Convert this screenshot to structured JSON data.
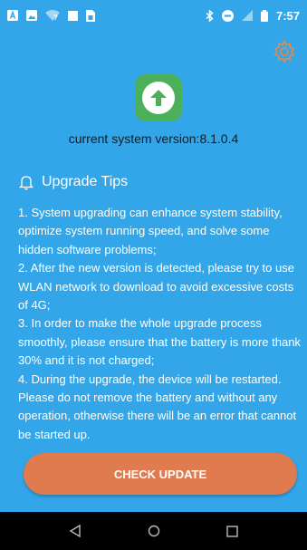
{
  "status_bar": {
    "time": "7:57",
    "left_icons": [
      "notification-a-icon",
      "image-icon",
      "wifi-question-icon",
      "square-icon",
      "sim-icon"
    ],
    "right_icons": [
      "bluetooth-icon",
      "do-not-disturb-icon",
      "signal-icon",
      "battery-icon"
    ]
  },
  "header": {
    "settings_icon": "gear-icon",
    "app_icon": "upgrade-arrow-icon",
    "version_text": "current system version:8.1.0.4"
  },
  "tips": {
    "title": "Upgrade Tips",
    "icon": "bell-icon",
    "items": [
      "1. System upgrading can enhance system stability, optimize system running speed, and solve some hidden software problems;",
      "2. After the new version is detected, please try to use WLAN network to download to avoid excessive costs of 4G;",
      "3. In order to make the whole upgrade process smoothly, please ensure that the battery is more thank 30% and it is not charged;",
      "4. During the upgrade, the device will be restarted. Please do not remove the battery and without any operation, otherwise there will be an error that cannot be started up."
    ]
  },
  "actions": {
    "check_update_label": "CHECK UPDATE"
  },
  "nav_bar": {
    "back_icon": "back-triangle-icon",
    "home_icon": "home-circle-icon",
    "recents_icon": "recents-square-icon"
  },
  "colors": {
    "background": "#33A6E9",
    "button": "#E07A4F",
    "app_icon_bg": "#4CB05A",
    "gear": "#E58A4A"
  }
}
